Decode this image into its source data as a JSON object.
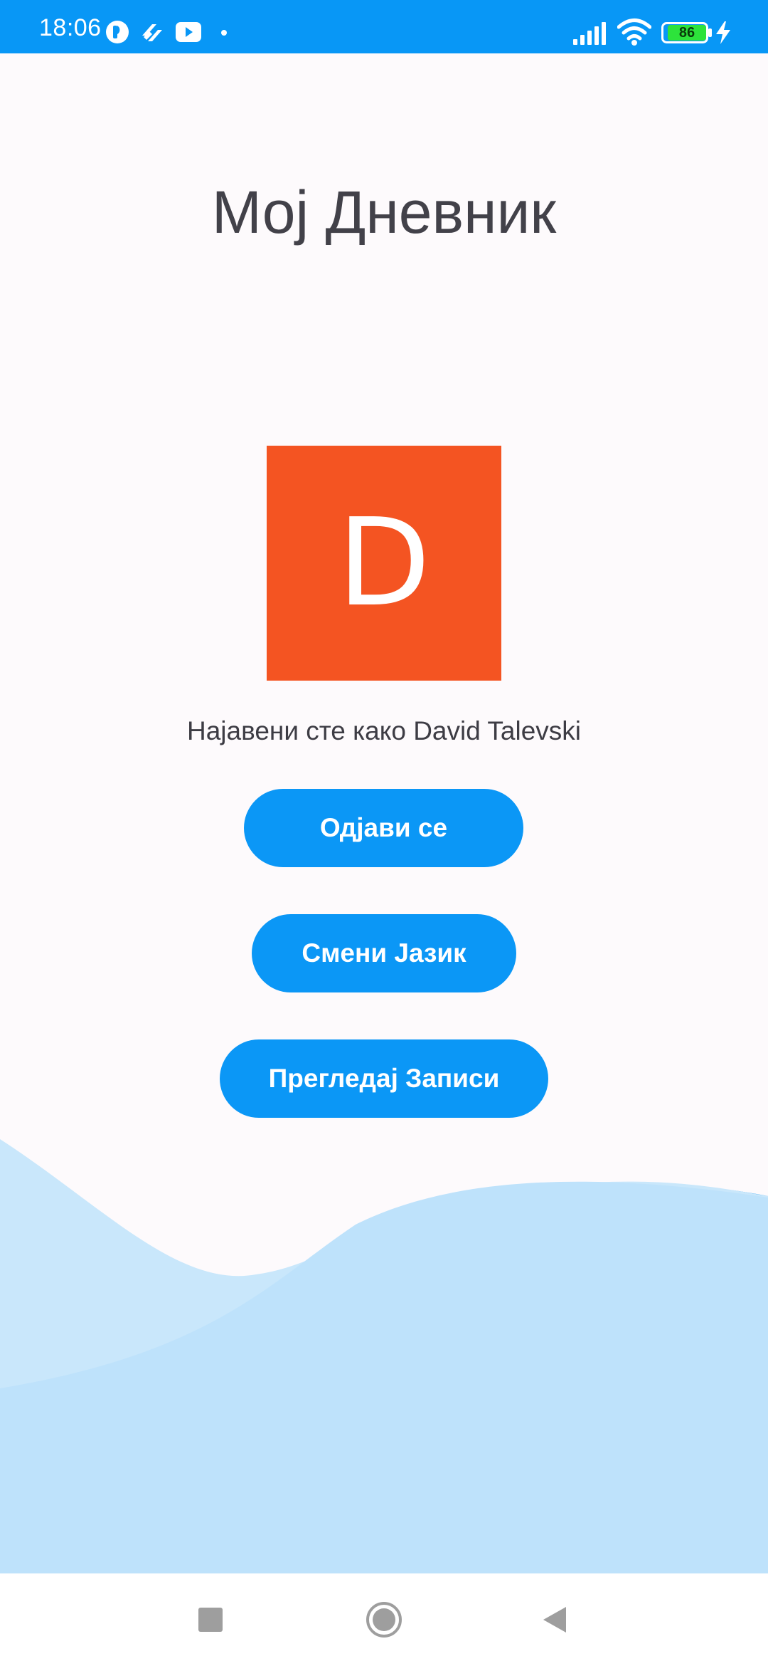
{
  "status_bar": {
    "time": "18:06",
    "battery_level": "86",
    "icons": [
      "notification-app-icon",
      "notification-app-icon",
      "youtube-icon",
      "more-notifications-dot",
      "signal-icon",
      "wifi-icon",
      "battery-icon",
      "charging-icon"
    ]
  },
  "main": {
    "title": "Мој Дневник",
    "avatar_letter": "D",
    "login_status": "Најавени сте како David Talevski"
  },
  "buttons": {
    "logout": "Одјави се",
    "change_language": "Смени Јазик",
    "view_entries": "Прегледај Записи"
  },
  "colors": {
    "status_bar": "#0897F6",
    "background": "#FDFAFC",
    "accent_button": "#0B97F6",
    "avatar_background": "#F45422",
    "title_text": "#424149",
    "wave_front": "#BEE2FB",
    "wave_middle": "#C9E7FB",
    "wave_back": "#3BA9F8"
  },
  "nav_bar": {
    "buttons": [
      "recents-icon",
      "home-icon",
      "back-icon"
    ]
  }
}
